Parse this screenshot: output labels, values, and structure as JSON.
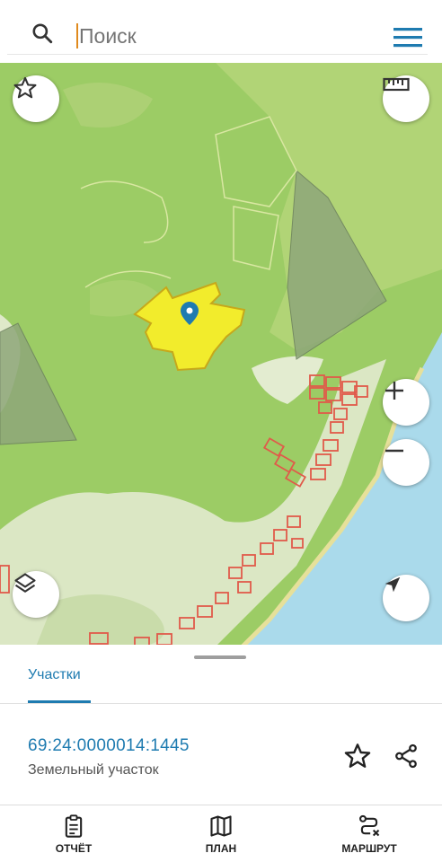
{
  "search": {
    "placeholder": "Поиск"
  },
  "sheet": {
    "tab_label": "Участки",
    "parcel": {
      "cadastral_number": "69:24:0000014:1445",
      "type": "Земельный участок"
    }
  },
  "bottom_nav": [
    {
      "label": "ОТЧЁТ",
      "icon": "clipboard-icon"
    },
    {
      "label": "ПЛАН",
      "icon": "map-icon"
    },
    {
      "label": "МАРШРУТ",
      "icon": "route-icon"
    }
  ],
  "colors": {
    "accent": "#1e7bb0",
    "forest": "#9ccc65",
    "water": "#aadaeb",
    "selected_parcel": "#f2ec2c",
    "parcel_outline": "#e05a4a"
  }
}
